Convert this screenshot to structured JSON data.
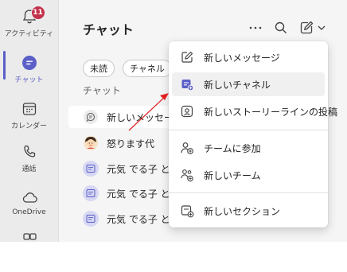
{
  "rail": {
    "items": [
      {
        "label": "アクティビティ",
        "badge": "11",
        "icon": "bell-icon"
      },
      {
        "label": "チャット",
        "icon": "chat-icon",
        "active": true
      },
      {
        "label": "カレンダー",
        "icon": "calendar-icon"
      },
      {
        "label": "通話",
        "icon": "phone-icon"
      },
      {
        "label": "OneDrive",
        "icon": "cloud-icon"
      }
    ]
  },
  "chat": {
    "title": "チャット",
    "filters": [
      "未読",
      "チャネル"
    ],
    "section_label": "チャット",
    "rows": [
      {
        "name": "新しいメッセージ",
        "icon": "chat-draft-icon"
      },
      {
        "name": "怒ります代",
        "icon": "avatar"
      },
      {
        "name": "元気 でる子 と",
        "icon": "group-chat-icon"
      },
      {
        "name": "元気 でる子 と",
        "icon": "group-chat-icon"
      },
      {
        "name": "元気 でる子 と",
        "icon": "group-chat-icon"
      }
    ]
  },
  "menu": {
    "items": [
      {
        "label": "新しいメッセージ",
        "icon": "compose-icon"
      },
      {
        "label": "新しいチャネル",
        "icon": "new-channel-icon"
      },
      {
        "label": "新しいストーリーラインの投稿",
        "icon": "storyline-icon"
      },
      {
        "label": "チームに参加",
        "icon": "join-team-icon"
      },
      {
        "label": "新しいチーム",
        "icon": "new-team-icon"
      },
      {
        "label": "新しいセクション",
        "icon": "new-section-icon"
      }
    ]
  },
  "colors": {
    "accent": "#5b5fc7",
    "badge": "#c4314b",
    "annotation_arrow": "#e02020"
  }
}
